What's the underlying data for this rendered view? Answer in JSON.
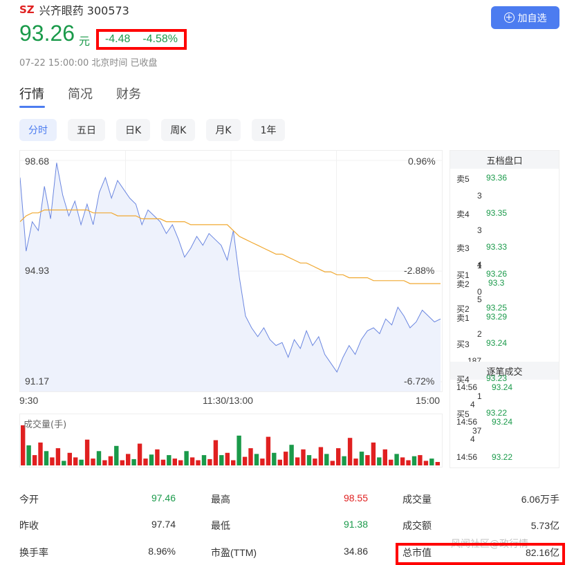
{
  "stock": {
    "market": "SZ",
    "name_code": "兴齐眼药 300573",
    "price": "93.26",
    "unit": "元",
    "change": "-4.48",
    "change_pct": "-4.58%",
    "time": "07-22 15:00:00 北京时间 已收盘"
  },
  "add_button": "加自选",
  "tabs": [
    "行情",
    "简况",
    "财务"
  ],
  "periods": [
    "分时",
    "五日",
    "日K",
    "周K",
    "月K",
    "1年"
  ],
  "chart_data": {
    "type": "line",
    "y_left": [
      "98.68",
      "94.93",
      "91.17"
    ],
    "y_right": [
      "0.96%",
      "-2.88%",
      "-6.72%"
    ],
    "x_ticks": [
      "9:30",
      "11:30/13:00",
      "15:00"
    ],
    "ylim": [
      91.17,
      98.68
    ],
    "series": [
      {
        "values": [
          98.1,
          95.6,
          96.6,
          96.3,
          97.8,
          96.7,
          98.6,
          97.5,
          96.8,
          97.3,
          96.5,
          97.2,
          96.5,
          97.6,
          98.1,
          97.4,
          98.0,
          97.7,
          97.4,
          97.2,
          96.5,
          97.0,
          96.8,
          96.6,
          96.2,
          96.5,
          96.0,
          95.4,
          95.7,
          96.1,
          95.8,
          96.2,
          96.0,
          95.8,
          95.3,
          96.3,
          94.7,
          93.4,
          93.0,
          92.7,
          93.0,
          92.6,
          92.4,
          92.5,
          92.0,
          92.6,
          92.3,
          92.9,
          92.4,
          92.7,
          92.1,
          91.8,
          91.5,
          92.0,
          92.4,
          92.1,
          92.6,
          92.9,
          93.0,
          92.8,
          93.3,
          93.1,
          93.7,
          93.4,
          93.0,
          93.2,
          93.6,
          93.4,
          93.2,
          93.3
        ]
      },
      {
        "values": [
          96.6,
          96.8,
          96.9,
          96.9,
          97.0,
          97.0,
          97.0,
          97.0,
          97.0,
          97.0,
          97.0,
          97.0,
          96.9,
          96.9,
          96.9,
          96.9,
          96.8,
          96.8,
          96.8,
          96.8,
          96.7,
          96.7,
          96.7,
          96.7,
          96.6,
          96.6,
          96.6,
          96.6,
          96.5,
          96.5,
          96.5,
          96.5,
          96.5,
          96.5,
          96.5,
          96.3,
          96.1,
          96.0,
          95.9,
          95.8,
          95.7,
          95.6,
          95.5,
          95.5,
          95.4,
          95.3,
          95.2,
          95.2,
          95.1,
          95.0,
          94.9,
          94.9,
          94.8,
          94.8,
          94.7,
          94.7,
          94.7,
          94.7,
          94.6,
          94.6,
          94.6,
          94.6,
          94.6,
          94.6,
          94.5,
          94.5,
          94.5,
          94.5,
          94.5,
          94.5
        ]
      }
    ],
    "volume_label": "成交量(手)",
    "volume": [
      70,
      35,
      18,
      40,
      25,
      14,
      30,
      8,
      22,
      14,
      10,
      45,
      12,
      25,
      9,
      16,
      34,
      9,
      20,
      11,
      38,
      12,
      19,
      28,
      10,
      18,
      12,
      9,
      25,
      14,
      9,
      18,
      11,
      44,
      18,
      22,
      9,
      52,
      15,
      30,
      20,
      12,
      50,
      22,
      10,
      24,
      36,
      14,
      28,
      18,
      12,
      32,
      20,
      8,
      30,
      16,
      48,
      12,
      24,
      18,
      40,
      14,
      28,
      10,
      20,
      14,
      9,
      16,
      18,
      8,
      12,
      6
    ]
  },
  "orderbook": {
    "title": "五档盘口",
    "rows": [
      {
        "label": "卖5",
        "price": "93.36",
        "qty": "3"
      },
      {
        "label": "卖4",
        "price": "93.35",
        "qty": "3"
      },
      {
        "label": "卖3",
        "price": "93.33",
        "qty": "4"
      }
    ],
    "stack": [
      {
        "label": "买1",
        "price": "93.26",
        "qty": ""
      },
      {
        "label": "卖2",
        "price": "93.3",
        "qty": "1"
      },
      {
        "label": "",
        "price": "",
        "qty": "0"
      },
      {
        "label": "买2",
        "price": "93.25",
        "qty": ""
      },
      {
        "label": "卖1",
        "price": "93.29",
        "qty": "5"
      },
      {
        "label": "",
        "price": "",
        "qty": "2"
      },
      {
        "label": "买3",
        "price": "93.24",
        "qty": ""
      }
    ],
    "tail_qty": "187",
    "trades_title": "逐笔成交",
    "trades": [
      {
        "label": "买4",
        "price": "93.23"
      },
      {
        "label": "14:56",
        "price": "93.24"
      },
      {
        "label": "",
        "price": "1"
      },
      {
        "label": "",
        "price": "4"
      },
      {
        "label": "买5",
        "price": "93.22"
      },
      {
        "label": "14:56",
        "price": "93.24"
      },
      {
        "label": "",
        "price": "37"
      },
      {
        "label": "",
        "price": "4"
      },
      {
        "label": "14:56",
        "price": "93.22"
      }
    ]
  },
  "stats": [
    [
      {
        "k": "今开",
        "v": "97.46",
        "c": "green"
      },
      {
        "k": "最高",
        "v": "98.55",
        "c": "red"
      },
      {
        "k": "成交量",
        "v": "6.06万手",
        "c": ""
      }
    ],
    [
      {
        "k": "昨收",
        "v": "97.74",
        "c": ""
      },
      {
        "k": "最低",
        "v": "91.38",
        "c": "green"
      },
      {
        "k": "成交额",
        "v": "5.73亿",
        "c": ""
      }
    ],
    [
      {
        "k": "换手率",
        "v": "8.96%",
        "c": ""
      },
      {
        "k": "市盈(TTM)",
        "v": "34.86",
        "c": ""
      },
      {
        "k": "总市值",
        "v": "82.16亿",
        "c": ""
      }
    ]
  ],
  "watermark": "风闻社区@政行情",
  "colors": {
    "accent": "#4c7cf0",
    "up": "#e02020",
    "down": "#1a9a4a",
    "avg_line": "#f0a830",
    "price_line": "#6a86e0"
  }
}
